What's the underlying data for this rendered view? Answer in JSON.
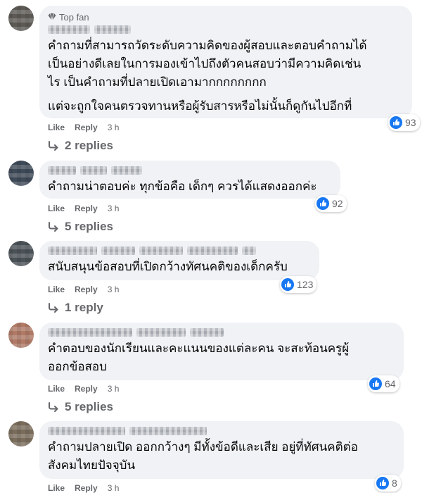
{
  "common": {
    "like_label": "Like",
    "reply_label": "Reply",
    "time": "3 h",
    "badge_label": "Top fan"
  },
  "comments": [
    {
      "avatar_color": "#5d5a55",
      "text": "คำถามที่สามารถวัดระดับความคิดของผู้สอบและตอบคำถามได้\nเป็นอย่างดีเลยในการมองเข้าไปถึงตัวคนสอบว่ามีความคิดเช่น\nไร เป็นคำถามที่ปลายเปิดเอามากกกกกกกก",
      "text2": "แต่จะถูกใจคนตรวจทานหรือผู้รับสารหรือไม่นั้นก็ดูกันไปอีกที่",
      "reactions": "93",
      "replies": "2 replies"
    },
    {
      "avatar_color": "#3f4a58",
      "text": "คำถามน่าตอบค่ะ ทุกข้อคือ เด็กๆ ควรได้แสดงออกค่ะ",
      "reactions": "92",
      "replies": "5 replies"
    },
    {
      "avatar_color": "#4b5257",
      "text": "สนับสนุนข้อสอบที่เปิดกว้างทัศนคติของเด็กครับ",
      "reactions": "123",
      "replies": "1 reply"
    },
    {
      "avatar_color": "#b07a66",
      "text": "คำตอบของนักเรียนและคะแนนของแต่ละคน จะสะท้อนครูผู้\nออกข้อสอบ",
      "reactions": "64",
      "replies": "5 replies"
    },
    {
      "avatar_color": "#7a6d5c",
      "text": "คำถามปลายเปิด ออกกว้างๆ มีทั้งข้อดีและเสีย อยู่ที่ทัศนคติต่อ\nสังคมไทยปัจจุบัน",
      "reactions": "8"
    }
  ]
}
